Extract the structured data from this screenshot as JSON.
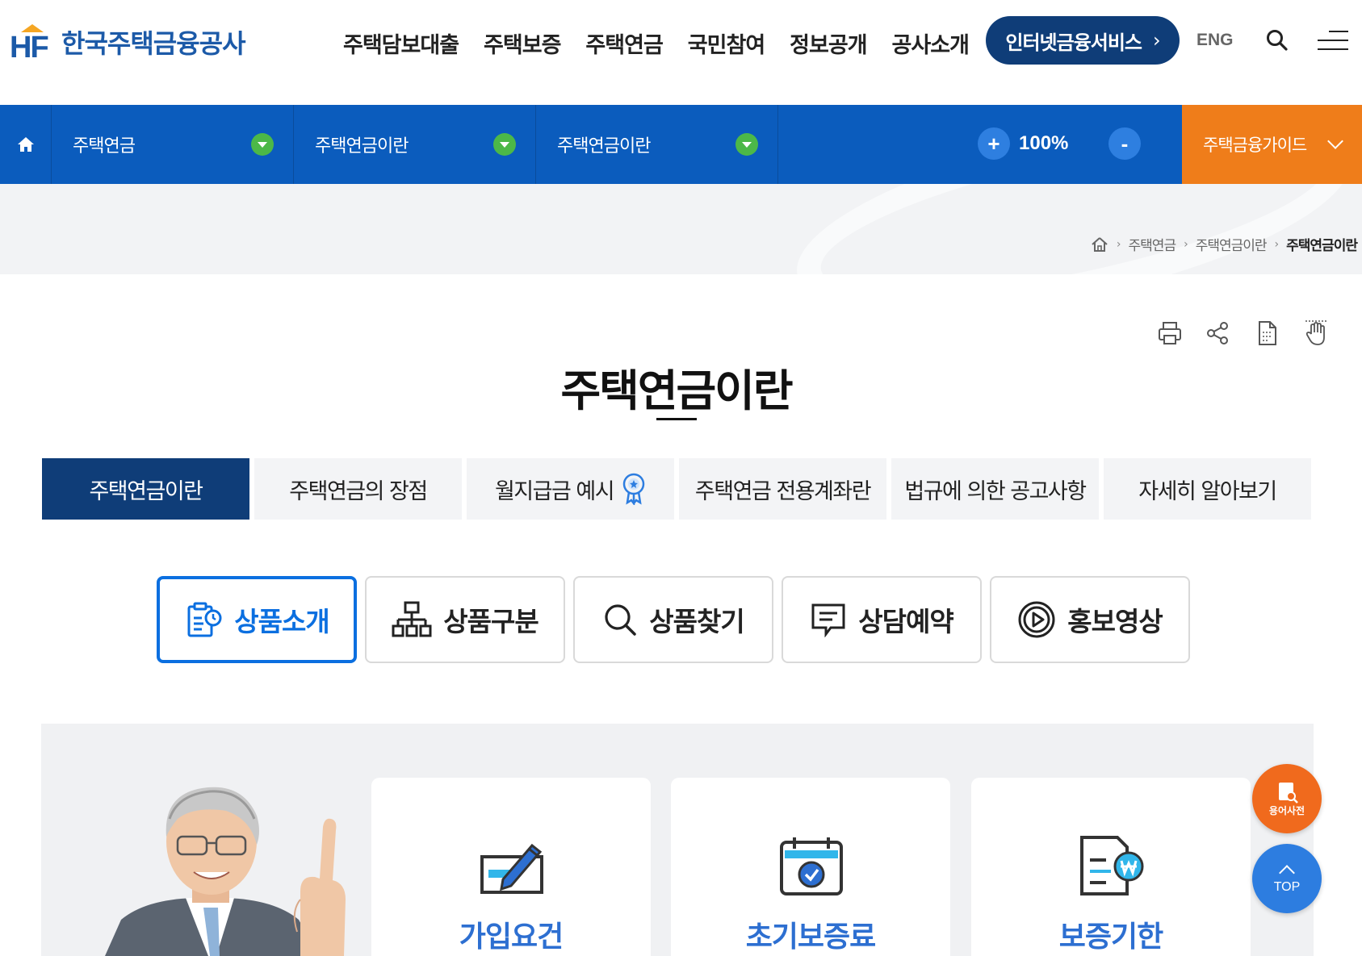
{
  "header": {
    "logo_text": "한국주택금융공사",
    "logo_mark": "HF",
    "nav": [
      "주택담보대출",
      "주택보증",
      "주택연금",
      "국민참여",
      "정보공개",
      "공사소개"
    ],
    "internet_service": "인터넷금융서비스",
    "lang": "ENG"
  },
  "locbar": {
    "depth1": "주택연금",
    "depth2": "주택연금이란",
    "depth3": "주택연금이란",
    "zoom": "100%",
    "zoom_plus": "+",
    "zoom_minus": "-",
    "guide": "주택금융가이드"
  },
  "breadcrumb": [
    "주택연금",
    "주택연금이란",
    "주택연금이란"
  ],
  "page_title": "주택연금이란",
  "tabs": [
    "주택연금이란",
    "주택연금의 장점",
    "월지급금 예시",
    "주택연금 전용계좌란",
    "법규에 의한 공고사항",
    "자세히 알아보기"
  ],
  "sub_buttons": [
    "상품소개",
    "상품구분",
    "상품찾기",
    "상담예약",
    "홍보영상"
  ],
  "cards": [
    "가입요건",
    "초기보증료",
    "보증기한"
  ],
  "floating": {
    "dict": "용어사전",
    "top": "TOP"
  },
  "colors": {
    "brand": "#0f3d78",
    "bar": "#0b5cbd",
    "orange": "#ef7d1a",
    "green": "#4cb848",
    "accent": "#0b6fe0"
  }
}
